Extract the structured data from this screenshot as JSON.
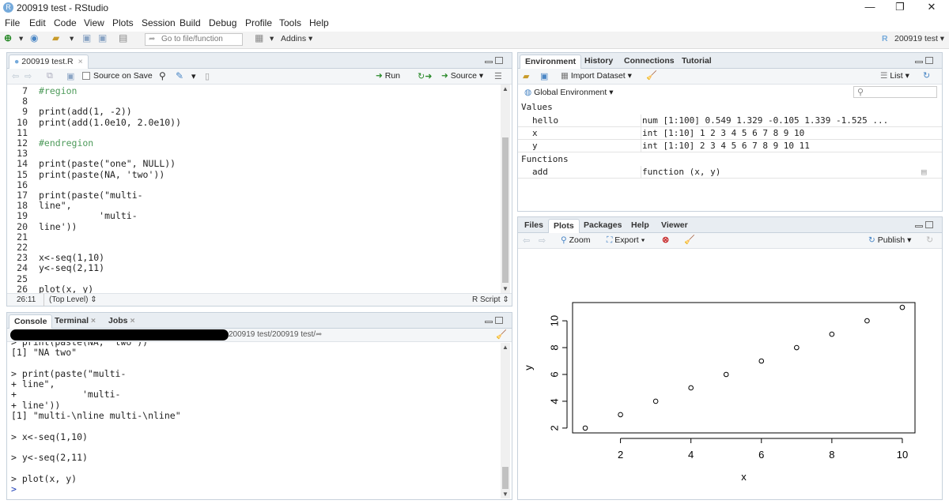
{
  "window": {
    "title": "200919 test - RStudio",
    "minimize": "—",
    "restore": "❐",
    "close": "✕"
  },
  "menu": [
    "File",
    "Edit",
    "Code",
    "View",
    "Plots",
    "Session",
    "Build",
    "Debug",
    "Profile",
    "Tools",
    "Help"
  ],
  "toolbar": {
    "goto_placeholder": "Go to file/function",
    "addins": "Addins",
    "project": "200919 test"
  },
  "editor": {
    "tab": "200919 test.R",
    "source_on_save": "Source on Save",
    "run": "Run",
    "source": "Source",
    "lines": [
      {
        "n": "7",
        "t": "#region"
      },
      {
        "n": "8",
        "t": ""
      },
      {
        "n": "9",
        "t": "print(add(1, -2))"
      },
      {
        "n": "10",
        "t": "print(add(1.0e10, 2.0e10))"
      },
      {
        "n": "11",
        "t": ""
      },
      {
        "n": "12",
        "t": "#endregion"
      },
      {
        "n": "13",
        "t": ""
      },
      {
        "n": "14",
        "t": "print(paste(\"one\", NULL))"
      },
      {
        "n": "15",
        "t": "print(paste(NA, 'two'))"
      },
      {
        "n": "16",
        "t": ""
      },
      {
        "n": "17",
        "t": "print(paste(\"multi-"
      },
      {
        "n": "18",
        "t": "line\","
      },
      {
        "n": "19",
        "t": "           'multi-"
      },
      {
        "n": "20",
        "t": "line'))"
      },
      {
        "n": "21",
        "t": ""
      },
      {
        "n": "22",
        "t": ""
      },
      {
        "n": "23",
        "t": "x<-seq(1,10)"
      },
      {
        "n": "24",
        "t": "y<-seq(2,11)"
      },
      {
        "n": "25",
        "t": ""
      },
      {
        "n": "26",
        "t": "plot(x, y)"
      }
    ],
    "status_pos": "26:11",
    "status_scope": "(Top Level)",
    "status_type": "R Script"
  },
  "console": {
    "tabs": [
      "Console",
      "Terminal",
      "Jobs"
    ],
    "path": "200919 test/200919 test/",
    "lines": [
      "> print(paste(NA, 'two'))",
      "[1] \"NA two\"",
      "",
      "> print(paste(\"multi-",
      "+ line\",",
      "+            'multi-",
      "+ line'))",
      "[1] \"multi-\\nline multi-\\nline\"",
      "",
      "> x<-seq(1,10)",
      "",
      "> y<-seq(2,11)",
      "",
      "> plot(x, y)",
      "> "
    ]
  },
  "environment": {
    "tabs": [
      "Environment",
      "History",
      "Connections",
      "Tutorial"
    ],
    "import": "Import Dataset",
    "view_mode": "List",
    "scope": "Global Environment",
    "values_header": "Values",
    "functions_header": "Functions",
    "values": [
      {
        "name": "hello",
        "value": "num [1:100] 0.549 1.329 -0.105 1.339 -1.525 ..."
      },
      {
        "name": "x",
        "value": "int [1:10] 1 2 3 4 5 6 7 8 9 10"
      },
      {
        "name": "y",
        "value": "int [1:10] 2 3 4 5 6 7 8 9 10 11"
      }
    ],
    "functions": [
      {
        "name": "add",
        "value": "function (x, y)"
      }
    ]
  },
  "files": {
    "tabs": [
      "Files",
      "Plots",
      "Packages",
      "Help",
      "Viewer"
    ],
    "zoom": "Zoom",
    "export": "Export",
    "publish": "Publish"
  },
  "chart_data": {
    "type": "scatter",
    "title": "",
    "xlabel": "x",
    "ylabel": "y",
    "x": [
      1,
      2,
      3,
      4,
      5,
      6,
      7,
      8,
      9,
      10
    ],
    "y": [
      2,
      3,
      4,
      5,
      6,
      7,
      8,
      9,
      10,
      11
    ],
    "xlim": [
      0.64,
      10.36
    ],
    "ylim": [
      1.64,
      11.36
    ],
    "xticks": [
      2,
      4,
      6,
      8,
      10
    ],
    "yticks": [
      2,
      4,
      6,
      8,
      10
    ],
    "grid": false
  }
}
